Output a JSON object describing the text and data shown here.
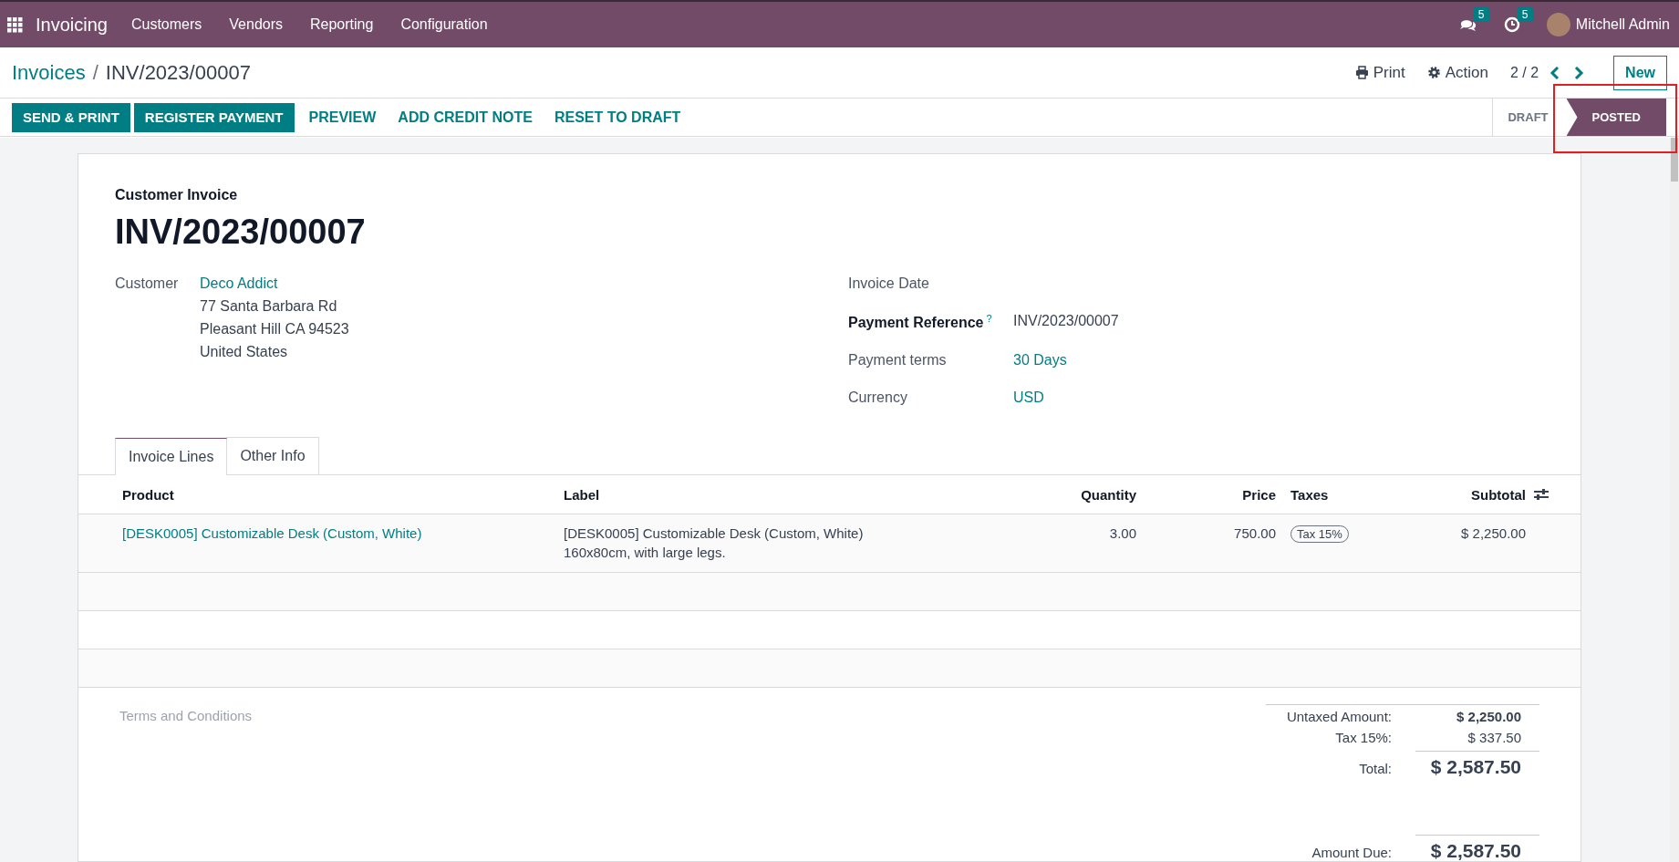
{
  "navbar": {
    "app_name": "Invoicing",
    "menu": [
      "Customers",
      "Vendors",
      "Reporting",
      "Configuration"
    ],
    "messages_count": "5",
    "activities_count": "5",
    "user_name": "Mitchell Admin"
  },
  "breadcrumb": {
    "parent": "Invoices",
    "separator": "/",
    "current": "INV/2023/00007"
  },
  "control_panel": {
    "print": "Print",
    "action": "Action",
    "pager": "2 / 2",
    "new_button": "New"
  },
  "action_buttons": [
    {
      "label": "SEND & PRINT",
      "kind": "primary"
    },
    {
      "label": "REGISTER PAYMENT",
      "kind": "primary"
    },
    {
      "label": "PREVIEW",
      "kind": "link"
    },
    {
      "label": "ADD CREDIT NOTE",
      "kind": "link"
    },
    {
      "label": "RESET TO DRAFT",
      "kind": "link"
    }
  ],
  "statusbar": [
    {
      "label": "DRAFT",
      "selected": false
    },
    {
      "label": "POSTED",
      "selected": true
    }
  ],
  "form": {
    "type_label": "Customer Invoice",
    "number": "INV/2023/00007",
    "customer": {
      "label": "Customer",
      "name": "Deco Addict",
      "address": [
        "77 Santa Barbara Rd",
        "Pleasant Hill CA 94523",
        "United States"
      ]
    },
    "fields": [
      {
        "label": "Invoice Date",
        "emphasized": false,
        "kind": "empty"
      },
      {
        "label": "Payment Reference",
        "emphasized": true,
        "help": "?",
        "value": "INV/2023/00007",
        "kind": "text"
      },
      {
        "label": "Payment terms",
        "emphasized": false,
        "value": "30 Days",
        "kind": "link"
      },
      {
        "label": "Currency",
        "emphasized": false,
        "value": "USD",
        "kind": "link"
      }
    ]
  },
  "tabs": [
    {
      "label": "Invoice Lines",
      "selected": true
    },
    {
      "label": "Other Info",
      "selected": false
    }
  ],
  "table": {
    "columns": [
      "Product",
      "Label",
      "Quantity",
      "Price",
      "Taxes",
      "Subtotal"
    ],
    "rows": [
      {
        "product": "[DESK0005] Customizable Desk (Custom, White)",
        "label": [
          "[DESK0005] Customizable Desk (Custom, White)",
          "160x80cm, with large legs."
        ],
        "quantity": "3.00",
        "price": "750.00",
        "taxes": [
          "Tax 15%"
        ],
        "subtotal": "$ 2,250.00"
      }
    ]
  },
  "terms_placeholder": "Terms and Conditions",
  "totals": [
    {
      "label": "Untaxed Amount:",
      "value": "$ 2,250.00",
      "kind": "subtotal"
    },
    {
      "label": "Tax 15%:",
      "value": "$ 337.50",
      "kind": "tax"
    },
    {
      "label": "Total:",
      "value": "$ 2,587.50",
      "kind": "total"
    },
    {
      "label": "Amount Due:",
      "value": "$ 2,587.50",
      "kind": "due"
    }
  ]
}
